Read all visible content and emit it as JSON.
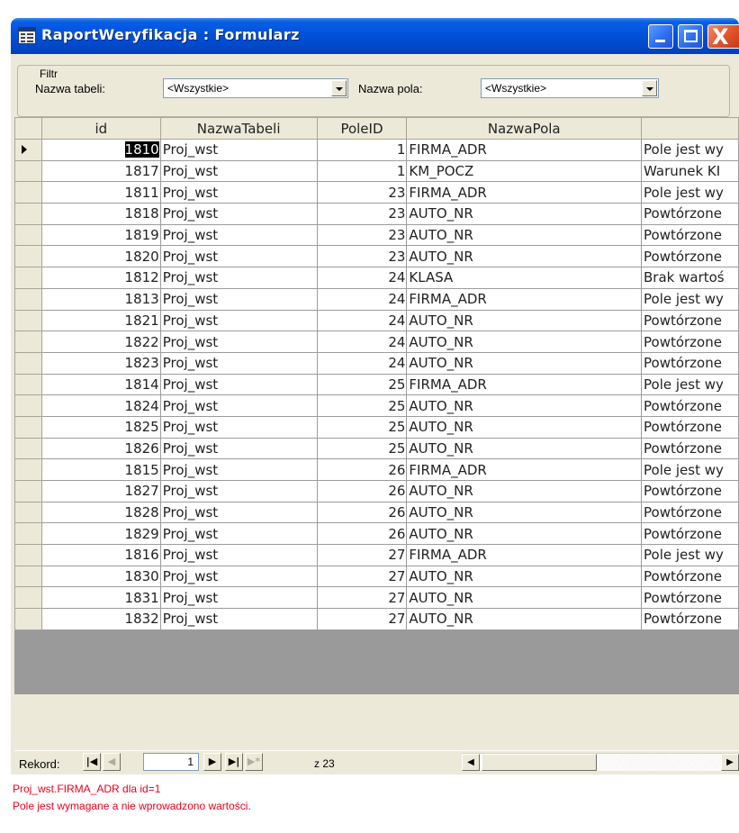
{
  "window": {
    "title": "RaportWeryfikacja : Formularz",
    "title_color": "#0052d9",
    "close_glyph": "X"
  },
  "filter": {
    "legend": "Filtr",
    "table_label": "Nazwa tabeli:",
    "table_value": "<Wszystkie>",
    "field_label": "Nazwa pola:",
    "field_value": "<Wszystkie>"
  },
  "grid": {
    "columns": [
      "id",
      "NazwaTabeli",
      "PoleID",
      "NazwaPola",
      ""
    ],
    "rows": [
      [
        "1810",
        "Proj_wst",
        "1",
        "FIRMA_ADR",
        "Pole jest wy"
      ],
      [
        "1817",
        "Proj_wst",
        "1",
        "KM_POCZ",
        "Warunek KI"
      ],
      [
        "1811",
        "Proj_wst",
        "23",
        "FIRMA_ADR",
        "Pole jest wy"
      ],
      [
        "1818",
        "Proj_wst",
        "23",
        "AUTO_NR",
        "Powtórzone"
      ],
      [
        "1819",
        "Proj_wst",
        "23",
        "AUTO_NR",
        "Powtórzone"
      ],
      [
        "1820",
        "Proj_wst",
        "23",
        "AUTO_NR",
        "Powtórzone"
      ],
      [
        "1812",
        "Proj_wst",
        "24",
        "KLASA",
        "Brak wartoś"
      ],
      [
        "1813",
        "Proj_wst",
        "24",
        "FIRMA_ADR",
        "Pole jest wy"
      ],
      [
        "1821",
        "Proj_wst",
        "24",
        "AUTO_NR",
        "Powtórzone"
      ],
      [
        "1822",
        "Proj_wst",
        "24",
        "AUTO_NR",
        "Powtórzone"
      ],
      [
        "1823",
        "Proj_wst",
        "24",
        "AUTO_NR",
        "Powtórzone"
      ],
      [
        "1814",
        "Proj_wst",
        "25",
        "FIRMA_ADR",
        "Pole jest wy"
      ],
      [
        "1824",
        "Proj_wst",
        "25",
        "AUTO_NR",
        "Powtórzone"
      ],
      [
        "1825",
        "Proj_wst",
        "25",
        "AUTO_NR",
        "Powtórzone"
      ],
      [
        "1826",
        "Proj_wst",
        "25",
        "AUTO_NR",
        "Powtórzone"
      ],
      [
        "1815",
        "Proj_wst",
        "26",
        "FIRMA_ADR",
        "Pole jest wy"
      ],
      [
        "1827",
        "Proj_wst",
        "26",
        "AUTO_NR",
        "Powtórzone"
      ],
      [
        "1828",
        "Proj_wst",
        "26",
        "AUTO_NR",
        "Powtórzone"
      ],
      [
        "1829",
        "Proj_wst",
        "26",
        "AUTO_NR",
        "Powtórzone"
      ],
      [
        "1816",
        "Proj_wst",
        "27",
        "FIRMA_ADR",
        "Pole jest wy"
      ],
      [
        "1830",
        "Proj_wst",
        "27",
        "AUTO_NR",
        "Powtórzone"
      ],
      [
        "1831",
        "Proj_wst",
        "27",
        "AUTO_NR",
        "Powtórzone"
      ],
      [
        "1832",
        "Proj_wst",
        "27",
        "AUTO_NR",
        "Powtórzone"
      ]
    ],
    "current_row": 0
  },
  "navigation": {
    "label": "Rekord:",
    "current_record": "1",
    "total_text": "z 23",
    "first_icon": "first-record-icon",
    "prev_icon": "previous-record-icon",
    "next_icon": "next-record-icon",
    "last_icon": "last-record-icon",
    "new_icon": "new-record-icon"
  },
  "status": {
    "line1": "Proj_wst.FIRMA_ADR dla id=1",
    "line2": "Pole jest wymagane a nie wprowadzono wartości.",
    "color": "#e8001c"
  }
}
